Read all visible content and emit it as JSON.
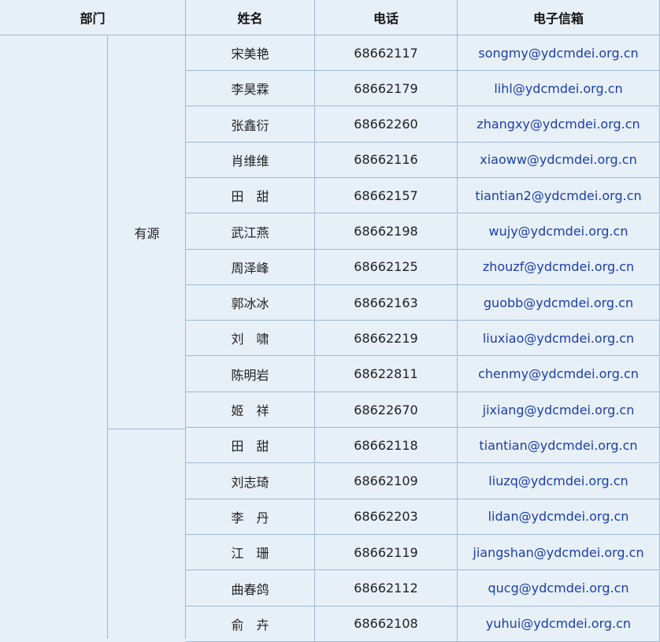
{
  "headers": {
    "dept": "部门",
    "name": "姓名",
    "phone": "电话",
    "email": "电子信箱"
  },
  "group1": {
    "label": "有源",
    "rows": [
      {
        "name": "宋美艳",
        "phone": "68662117",
        "email": "songmy@ydcmdei.org.cn"
      },
      {
        "name": "李昊霖",
        "phone": "68662179",
        "email": "lihl@ydcmdei.org.cn"
      },
      {
        "name": "张鑫衍",
        "phone": "68662260",
        "email": "zhangxy@ydcmdei.org.cn"
      },
      {
        "name": "肖维维",
        "phone": "68662116",
        "email": "xiaoww@ydcmdei.org.cn"
      },
      {
        "name": "田　甜",
        "phone": "68662157",
        "email": "tiantian2@ydcmdei.org.cn"
      },
      {
        "name": "武江燕",
        "phone": "68662198",
        "email": "wujy@ydcmdei.org.cn"
      },
      {
        "name": "周泽峰",
        "phone": "68662125",
        "email": "zhouzf@ydcmdei.org.cn"
      },
      {
        "name": "郭冰冰",
        "phone": "68662163",
        "email": "guobb@ydcmdei.org.cn"
      },
      {
        "name": "刘　啸",
        "phone": "68662219",
        "email": "liuxiao@ydcmdei.org.cn"
      },
      {
        "name": "陈明岩",
        "phone": "68622811",
        "email": "chenmy@ydcmdei.org.cn"
      },
      {
        "name": "姬　祥",
        "phone": "68622670",
        "email": "jixiang@ydcmdei.org.cn"
      }
    ]
  },
  "group2": {
    "rows": [
      {
        "name": "田　甜",
        "phone": "68662118",
        "email": "tiantian@ydcmdei.org.cn"
      },
      {
        "name": "刘志琦",
        "phone": "68662109",
        "email": "liuzq@ydcmdei.org.cn"
      },
      {
        "name": "李　丹",
        "phone": "68662203",
        "email": "lidan@ydcmdei.org.cn"
      },
      {
        "name": "江　珊",
        "phone": "68662119",
        "email": "jiangshan@ydcmdei.org.cn"
      },
      {
        "name": "曲春鸽",
        "phone": "68662112",
        "email": "qucg@ydcmdei.org.cn"
      },
      {
        "name": "俞　卉",
        "phone": "68662108",
        "email": "yuhui@ydcmdei.org.cn"
      }
    ]
  }
}
